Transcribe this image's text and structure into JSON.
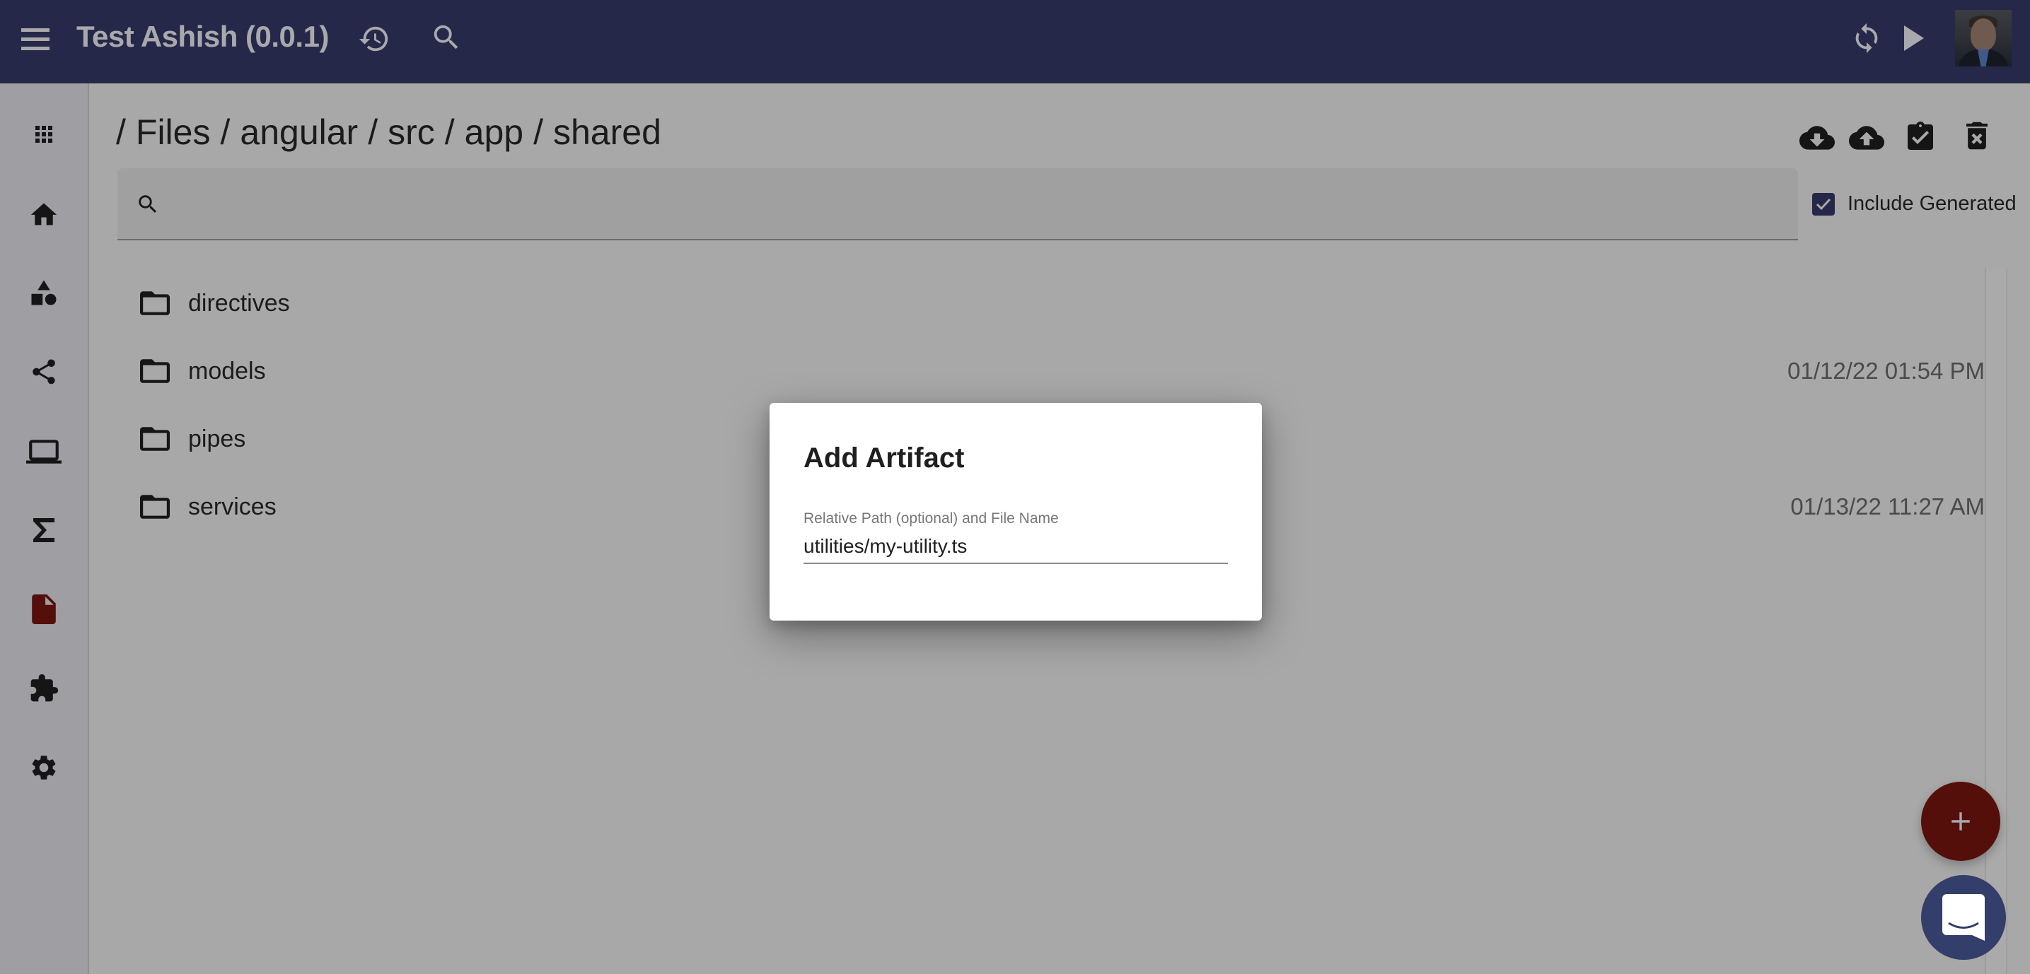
{
  "app": {
    "title": "Test Ashish (0.0.1)"
  },
  "topbar": {
    "icons": {
      "menu": "menu-icon",
      "history": "history-icon",
      "search": "search-icon",
      "sync": "sync-icon",
      "run": "play-icon",
      "avatar": "user-avatar"
    }
  },
  "sidebar": {
    "items": [
      {
        "name": "apps",
        "icon": "apps-grid-icon"
      },
      {
        "name": "home",
        "icon": "home-icon"
      },
      {
        "name": "shapes",
        "icon": "shapes-icon"
      },
      {
        "name": "share",
        "icon": "share-icon"
      },
      {
        "name": "computer",
        "icon": "laptop-icon"
      },
      {
        "name": "functions",
        "icon": "sigma-icon"
      },
      {
        "name": "files",
        "icon": "file-icon",
        "active": true
      },
      {
        "name": "extensions",
        "icon": "puzzle-icon"
      },
      {
        "name": "settings",
        "icon": "gear-icon"
      }
    ],
    "active_color": "#540f0a"
  },
  "breadcrumb": {
    "segments": [
      "Files",
      "angular",
      "src",
      "app",
      "shared"
    ],
    "separator": "/"
  },
  "toolbar": {
    "actions": [
      {
        "name": "download",
        "icon": "cloud-download-icon"
      },
      {
        "name": "upload",
        "icon": "cloud-upload-icon"
      },
      {
        "name": "validate",
        "icon": "clipboard-check-icon"
      },
      {
        "name": "delete",
        "icon": "delete-forever-icon"
      }
    ]
  },
  "search": {
    "value": "",
    "placeholder": ""
  },
  "include_generated": {
    "label": "Include Generated",
    "checked": true
  },
  "files": [
    {
      "name": "directives",
      "type": "folder",
      "modified": ""
    },
    {
      "name": "models",
      "type": "folder",
      "modified": "01/12/22 01:54 PM"
    },
    {
      "name": "pipes",
      "type": "folder",
      "modified": ""
    },
    {
      "name": "services",
      "type": "folder",
      "modified": "01/13/22 11:27 AM"
    }
  ],
  "dialog": {
    "title": "Add Artifact",
    "field_label": "Relative Path (optional) and File Name",
    "field_value": "utilities/my-utility.ts"
  },
  "fab": {
    "add_icon": "plus-icon",
    "add_color": "#540f0a",
    "chat_icon": "chat-icon",
    "chat_color": "#343e6a"
  },
  "colors": {
    "header": "#252849",
    "checkbox": "#252849"
  }
}
